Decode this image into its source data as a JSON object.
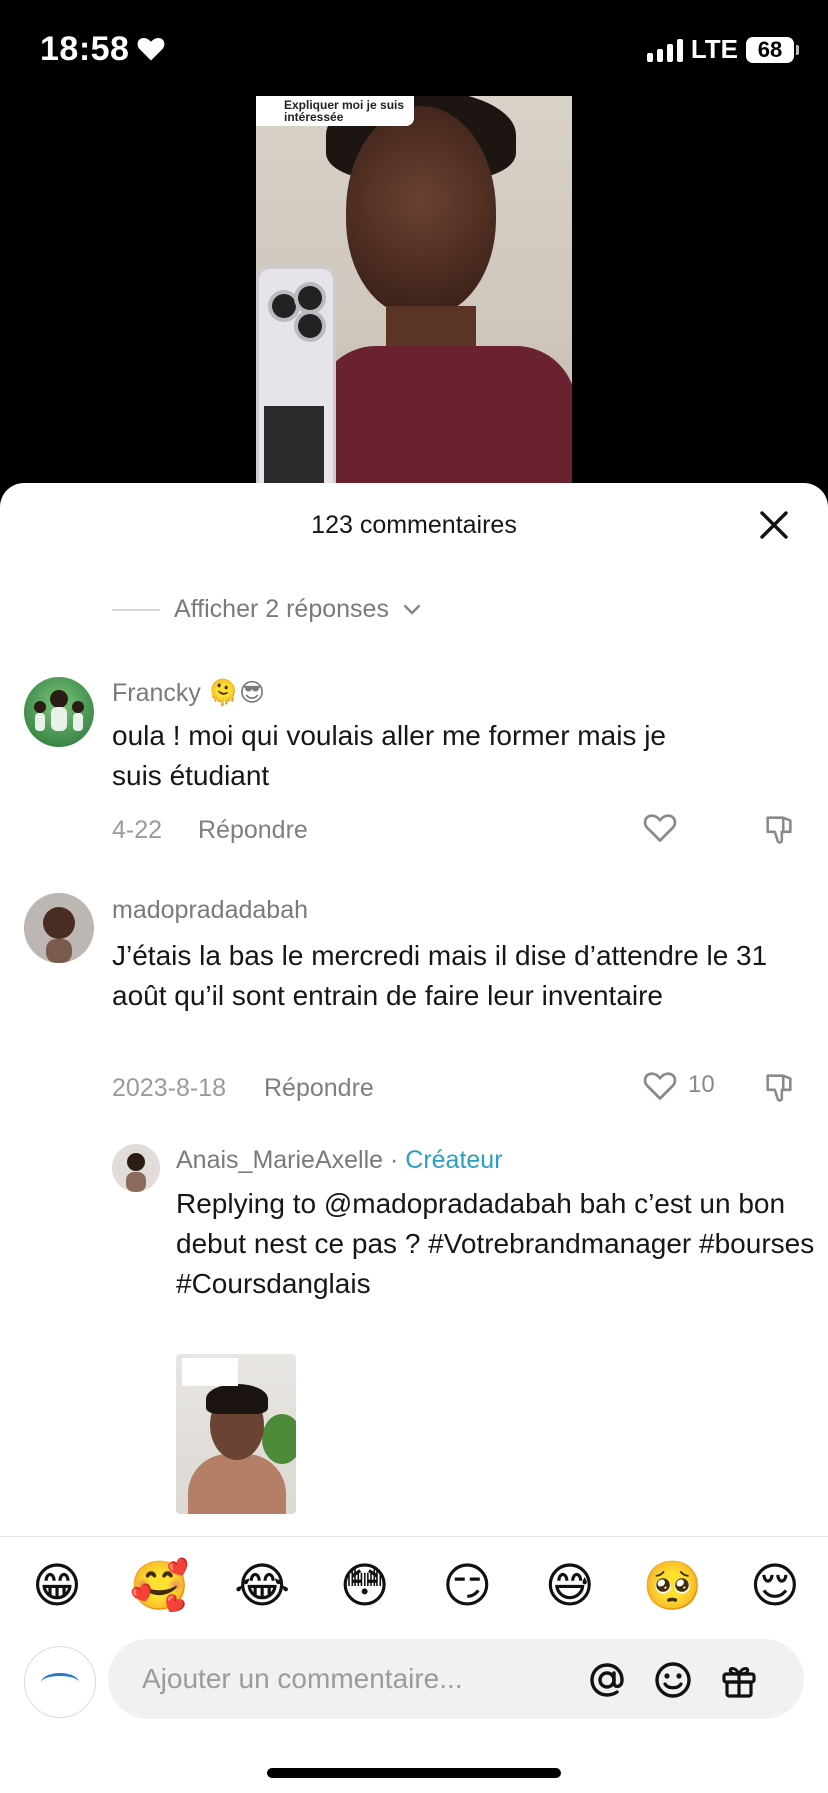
{
  "status": {
    "time": "18:58",
    "network": "LTE",
    "battery": "68"
  },
  "video": {
    "caption": "Expliquer moi je suis intéressée"
  },
  "sheet": {
    "title": "123 commentaires"
  },
  "replies_toggle": {
    "label": "Afficher 2 réponses"
  },
  "comments": [
    {
      "username": "Francky",
      "username_emoji": "🫠😎",
      "text": "oula ! moi qui voulais aller me former mais je suis étudiant",
      "date": "4-22",
      "reply_label": "Répondre",
      "likes": ""
    },
    {
      "username": "madopradadabah",
      "text": "J’étais la bas le mercredi mais il dise d’attendre le 31 août qu’il sont entrain de faire leur inventaire",
      "date": "2023-8-18",
      "reply_label": "Répondre",
      "likes": "10"
    },
    {
      "username": "Anais_MarieAxelle",
      "separator": " · ",
      "badge": "Créateur",
      "text": "Replying to @madopradadabah bah c’est un bon debut nest ce pas ? #Votrebrandmanager #bourses #Coursdanglais"
    }
  ],
  "emoji_bar": [
    "😁",
    "🥰",
    "😂",
    "😳",
    "😏",
    "😅",
    "🥺",
    "😌"
  ],
  "composer": {
    "placeholder": "Ajouter un commentaire..."
  },
  "icons": [
    "heart-icon",
    "close-icon",
    "chevron-down-icon",
    "like-icon",
    "dislike-icon",
    "mention-icon",
    "emoji-icon",
    "gift-icon"
  ]
}
